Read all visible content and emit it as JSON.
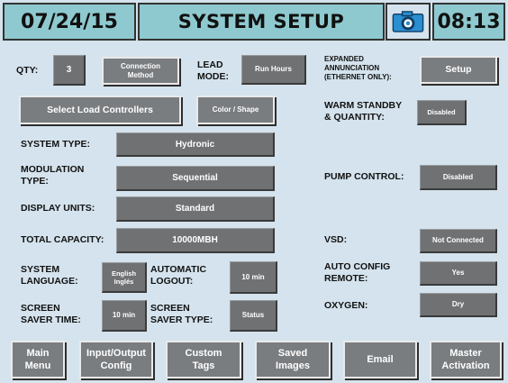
{
  "header": {
    "date": "07/24/15",
    "title": "SYSTEM SETUP",
    "camera_icon": "camera-icon",
    "time": "08:13"
  },
  "qty": {
    "label": "QTY:",
    "value": "3"
  },
  "connection_method_button": "Connection\nMethod",
  "lead_mode": {
    "label": "LEAD\nMODE:",
    "value": "Run Hours"
  },
  "expanded_annunciation": {
    "label": "EXPANDED\nANNUNCIATION\n(ETHERNET ONLY):",
    "button": "Setup"
  },
  "select_load_controllers_button": "Select Load Controllers",
  "color_shape_button": "Color / Shape",
  "warm_standby": {
    "label": "WARM STANDBY\n& QUANTITY:",
    "value": "Disabled"
  },
  "system_type": {
    "label": "SYSTEM TYPE:",
    "value": "Hydronic"
  },
  "modulation_type": {
    "label": "MODULATION\nTYPE:",
    "value": "Sequential"
  },
  "pump_control": {
    "label": "PUMP CONTROL:",
    "value": "Disabled"
  },
  "display_units": {
    "label": "DISPLAY UNITS:",
    "value": "Standard"
  },
  "total_capacity": {
    "label": "TOTAL CAPACITY:",
    "value": "10000MBH"
  },
  "vsd": {
    "label": "VSD:",
    "value": "Not Connected"
  },
  "system_language": {
    "label": "SYSTEM\nLANGUAGE:",
    "value": "English\nInglés"
  },
  "automatic_logout": {
    "label": "AUTOMATIC\nLOGOUT:",
    "value": "10 min"
  },
  "auto_config_remote": {
    "label": "AUTO CONFIG\nREMOTE:",
    "value": "Yes"
  },
  "screen_saver_time": {
    "label": "SCREEN\nSAVER TIME:",
    "value": "10 min"
  },
  "screen_saver_type": {
    "label": "SCREEN\nSAVER TYPE:",
    "value": "Status"
  },
  "oxygen": {
    "label": "OXYGEN:",
    "value": "Dry"
  },
  "nav": {
    "main_menu": "Main\nMenu",
    "input_output_config": "Input/Output\nConfig",
    "custom_tags": "Custom\nTags",
    "saved_images": "Saved\nImages",
    "email": "Email",
    "master_activation": "Master\nActivation"
  },
  "colors": {
    "header_bg": "#8ec9cf",
    "screen_bg": "#d4e3ed",
    "value_box": "#6f7173",
    "button": "#7a7d80"
  }
}
